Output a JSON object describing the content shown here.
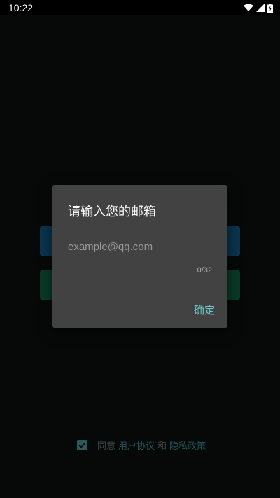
{
  "status_bar": {
    "time": "10:22",
    "icons": [
      "wifi-icon",
      "signal-icon",
      "battery-charging-icon"
    ]
  },
  "background": {
    "agreement": {
      "checked": true,
      "prefix": "同意",
      "user_agreement": "用户协议",
      "conjunction": "和",
      "privacy_policy": "隐私政策"
    }
  },
  "dialog": {
    "title": "请输入您的邮箱",
    "email_placeholder": "example@qq.com",
    "email_value": "",
    "counter": "0/32",
    "confirm_label": "确定"
  },
  "colors": {
    "accent": "#72c6c8",
    "dialog_bg": "#424242",
    "screen_bg": "#070909"
  }
}
